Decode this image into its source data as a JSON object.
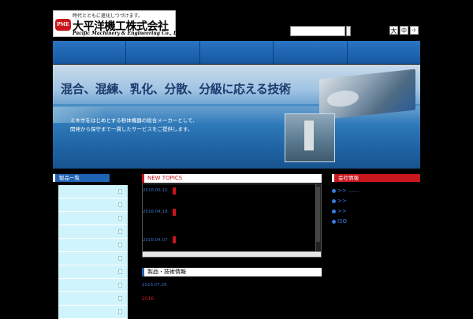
{
  "header": {
    "logo_mark": "PME",
    "tagline": "時代とともに進化しつづけます。",
    "company_name_jp": "大平洋機工株式会社",
    "company_name_en": "Pacific Machinery & Engineering Co., Ltd",
    "search": {
      "value": ""
    },
    "font_size": {
      "large": "大",
      "medium": "中",
      "small": "小"
    }
  },
  "nav": {
    "item_count": 5
  },
  "hero": {
    "headline": "混合、混練、乳化、分散、分級に応える技術",
    "sub_line1": "ミキサをはじめとする粉体機器の総合メーカーとして、",
    "sub_line2": "開発から保守まで一貫したサービスをご提供します。"
  },
  "sidebar": {
    "title": "製品一覧",
    "items": [
      "",
      "",
      "",
      "",
      "",
      "",
      "",
      "",
      "",
      ""
    ]
  },
  "news": {
    "title": "NEW TOPICS",
    "items": [
      {
        "date": "2016.06.10"
      },
      {
        "date": "2016.04.18"
      },
      {
        "date": "2016.04.07"
      }
    ]
  },
  "tech": {
    "title": "製品・技術情報",
    "date": "2016.07.26",
    "year": "2016"
  },
  "company": {
    "title": "会社情報",
    "links": [
      ">> ......",
      ">>",
      ">>",
      "ISO"
    ]
  },
  "colors": {
    "accent_red": "#c8161d",
    "accent_blue": "#1f63b5",
    "link_blue": "#3a7de0"
  }
}
